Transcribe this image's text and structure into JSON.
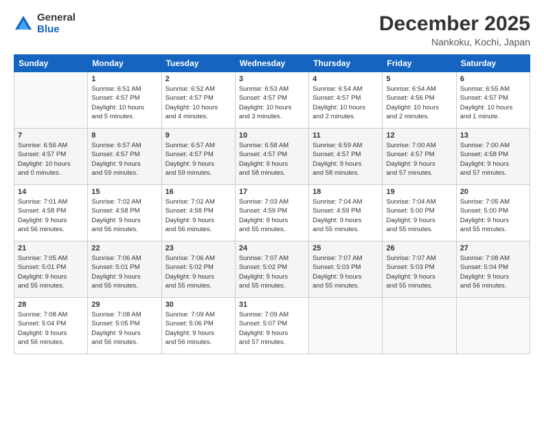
{
  "logo": {
    "general": "General",
    "blue": "Blue"
  },
  "header": {
    "title": "December 2025",
    "location": "Nankoku, Kochi, Japan"
  },
  "days_of_week": [
    "Sunday",
    "Monday",
    "Tuesday",
    "Wednesday",
    "Thursday",
    "Friday",
    "Saturday"
  ],
  "weeks": [
    [
      {
        "day": "",
        "info": ""
      },
      {
        "day": "1",
        "info": "Sunrise: 6:51 AM\nSunset: 4:57 PM\nDaylight: 10 hours\nand 5 minutes."
      },
      {
        "day": "2",
        "info": "Sunrise: 6:52 AM\nSunset: 4:57 PM\nDaylight: 10 hours\nand 4 minutes."
      },
      {
        "day": "3",
        "info": "Sunrise: 6:53 AM\nSunset: 4:57 PM\nDaylight: 10 hours\nand 3 minutes."
      },
      {
        "day": "4",
        "info": "Sunrise: 6:54 AM\nSunset: 4:57 PM\nDaylight: 10 hours\nand 2 minutes."
      },
      {
        "day": "5",
        "info": "Sunrise: 6:54 AM\nSunset: 4:56 PM\nDaylight: 10 hours\nand 2 minutes."
      },
      {
        "day": "6",
        "info": "Sunrise: 6:55 AM\nSunset: 4:57 PM\nDaylight: 10 hours\nand 1 minute."
      }
    ],
    [
      {
        "day": "7",
        "info": "Sunrise: 6:56 AM\nSunset: 4:57 PM\nDaylight: 10 hours\nand 0 minutes."
      },
      {
        "day": "8",
        "info": "Sunrise: 6:57 AM\nSunset: 4:57 PM\nDaylight: 9 hours\nand 59 minutes."
      },
      {
        "day": "9",
        "info": "Sunrise: 6:57 AM\nSunset: 4:57 PM\nDaylight: 9 hours\nand 59 minutes."
      },
      {
        "day": "10",
        "info": "Sunrise: 6:58 AM\nSunset: 4:57 PM\nDaylight: 9 hours\nand 58 minutes."
      },
      {
        "day": "11",
        "info": "Sunrise: 6:59 AM\nSunset: 4:57 PM\nDaylight: 9 hours\nand 58 minutes."
      },
      {
        "day": "12",
        "info": "Sunrise: 7:00 AM\nSunset: 4:57 PM\nDaylight: 9 hours\nand 57 minutes."
      },
      {
        "day": "13",
        "info": "Sunrise: 7:00 AM\nSunset: 4:58 PM\nDaylight: 9 hours\nand 57 minutes."
      }
    ],
    [
      {
        "day": "14",
        "info": "Sunrise: 7:01 AM\nSunset: 4:58 PM\nDaylight: 9 hours\nand 56 minutes."
      },
      {
        "day": "15",
        "info": "Sunrise: 7:02 AM\nSunset: 4:58 PM\nDaylight: 9 hours\nand 56 minutes."
      },
      {
        "day": "16",
        "info": "Sunrise: 7:02 AM\nSunset: 4:58 PM\nDaylight: 9 hours\nand 56 minutes."
      },
      {
        "day": "17",
        "info": "Sunrise: 7:03 AM\nSunset: 4:59 PM\nDaylight: 9 hours\nand 55 minutes."
      },
      {
        "day": "18",
        "info": "Sunrise: 7:04 AM\nSunset: 4:59 PM\nDaylight: 9 hours\nand 55 minutes."
      },
      {
        "day": "19",
        "info": "Sunrise: 7:04 AM\nSunset: 5:00 PM\nDaylight: 9 hours\nand 55 minutes."
      },
      {
        "day": "20",
        "info": "Sunrise: 7:05 AM\nSunset: 5:00 PM\nDaylight: 9 hours\nand 55 minutes."
      }
    ],
    [
      {
        "day": "21",
        "info": "Sunrise: 7:05 AM\nSunset: 5:01 PM\nDaylight: 9 hours\nand 55 minutes."
      },
      {
        "day": "22",
        "info": "Sunrise: 7:06 AM\nSunset: 5:01 PM\nDaylight: 9 hours\nand 55 minutes."
      },
      {
        "day": "23",
        "info": "Sunrise: 7:06 AM\nSunset: 5:02 PM\nDaylight: 9 hours\nand 55 minutes."
      },
      {
        "day": "24",
        "info": "Sunrise: 7:07 AM\nSunset: 5:02 PM\nDaylight: 9 hours\nand 55 minutes."
      },
      {
        "day": "25",
        "info": "Sunrise: 7:07 AM\nSunset: 5:03 PM\nDaylight: 9 hours\nand 55 minutes."
      },
      {
        "day": "26",
        "info": "Sunrise: 7:07 AM\nSunset: 5:03 PM\nDaylight: 9 hours\nand 55 minutes."
      },
      {
        "day": "27",
        "info": "Sunrise: 7:08 AM\nSunset: 5:04 PM\nDaylight: 9 hours\nand 56 minutes."
      }
    ],
    [
      {
        "day": "28",
        "info": "Sunrise: 7:08 AM\nSunset: 5:04 PM\nDaylight: 9 hours\nand 56 minutes."
      },
      {
        "day": "29",
        "info": "Sunrise: 7:08 AM\nSunset: 5:05 PM\nDaylight: 9 hours\nand 56 minutes."
      },
      {
        "day": "30",
        "info": "Sunrise: 7:09 AM\nSunset: 5:06 PM\nDaylight: 9 hours\nand 56 minutes."
      },
      {
        "day": "31",
        "info": "Sunrise: 7:09 AM\nSunset: 5:07 PM\nDaylight: 9 hours\nand 57 minutes."
      },
      {
        "day": "",
        "info": ""
      },
      {
        "day": "",
        "info": ""
      },
      {
        "day": "",
        "info": ""
      }
    ]
  ]
}
